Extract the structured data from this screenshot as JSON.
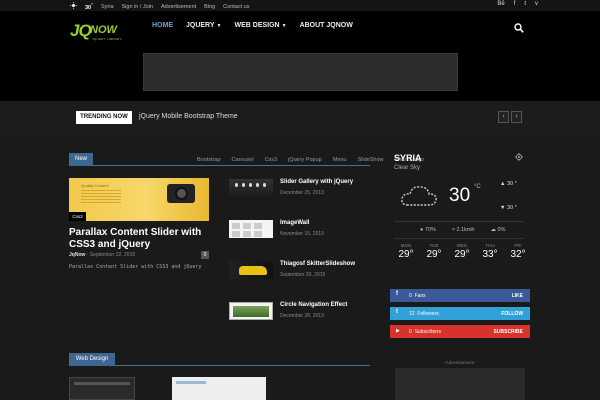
{
  "topbar": {
    "temperature": "30",
    "temp_unit": "°",
    "location": "Syria",
    "links": [
      "Sign in / Join",
      "Advertisement",
      "Blog",
      "Contact us"
    ],
    "social": [
      "Bē",
      "f",
      "t",
      "v"
    ]
  },
  "logo": {
    "mark": "JQ",
    "word": "NOW",
    "tagline": "JQUERY LIBRARY"
  },
  "nav": {
    "items": [
      {
        "label": "HOME",
        "active": true,
        "dropdown": false
      },
      {
        "label": "JQUERY",
        "active": false,
        "dropdown": true
      },
      {
        "label": "WEB DESIGN",
        "active": false,
        "dropdown": true
      },
      {
        "label": "ABOUT JQNOW",
        "active": false,
        "dropdown": false
      }
    ]
  },
  "trending": {
    "label": "TRENDING NOW",
    "title": "jQuery Mobile Bootstrap Theme",
    "prev": "‹",
    "next": "›"
  },
  "block": {
    "tab": "New",
    "filters": [
      "Bootstrap",
      "Carousel",
      "Css3",
      "jQuery Popup",
      "Menu",
      "SlideShow",
      "Web Design"
    ]
  },
  "featured": {
    "image_caption": "Quality Content",
    "category": "Css3",
    "title": "Parallax Content Slider with CSS3 and jQuery",
    "author": "JqNow",
    "date": "September 22, 2015",
    "comments": "0",
    "excerpt": "Parallax Content Slider with CSS3 and jQuery"
  },
  "posts": [
    {
      "title": "Slider Gallery with jQuery",
      "date": "December 25, 2013"
    },
    {
      "title": "ImageWall",
      "date": "November 15, 2013"
    },
    {
      "title": "Thiagosf SkitterSlideshow",
      "date": "September 20, 2015"
    },
    {
      "title": "Circle Navigation Effect",
      "date": "December 28, 2013"
    }
  ],
  "weather": {
    "city": "SYRIA",
    "description": "Clear Sky",
    "temp": "30",
    "unit": "°C",
    "high": "30 °",
    "low": "30 °",
    "humidity": "70%",
    "wind": "2.1kmh",
    "clouds": "0%",
    "forecast": [
      {
        "day": "MON",
        "temp": "29°"
      },
      {
        "day": "TUE",
        "temp": "29°"
      },
      {
        "day": "WED",
        "temp": "29°"
      },
      {
        "day": "THU",
        "temp": "33°"
      },
      {
        "day": "FRI",
        "temp": "32°"
      }
    ]
  },
  "social_counters": [
    {
      "icon": "f",
      "count": "0",
      "label": "Fans",
      "action": "LIKE",
      "color": "#3b5998"
    },
    {
      "icon": "t",
      "count": "12",
      "label": "Followers",
      "action": "FOLLOW",
      "color": "#30a2d9"
    },
    {
      "icon": "▶",
      "count": "0",
      "label": "Subscribers",
      "action": "SUBSCRIBE",
      "color": "#d9322b"
    }
  ],
  "web_design": {
    "tab": "Web Design"
  },
  "advertisement_label": "- Advertisement -"
}
